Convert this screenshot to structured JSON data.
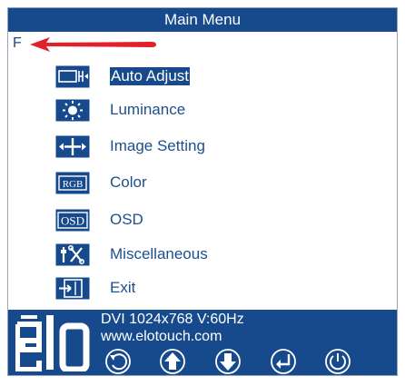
{
  "window": {
    "title": "Main Menu",
    "indicator": "F"
  },
  "menu": {
    "items": [
      {
        "label": "Auto Adjust",
        "icon": "auto-adjust-icon",
        "selected": true
      },
      {
        "label": "Luminance",
        "icon": "luminance-icon",
        "selected": false
      },
      {
        "label": "Image Setting",
        "icon": "image-setting-icon",
        "selected": false
      },
      {
        "label": "Color",
        "icon": "rgb-color-icon",
        "selected": false
      },
      {
        "label": "OSD",
        "icon": "osd-icon",
        "selected": false
      },
      {
        "label": "Miscellaneous",
        "icon": "miscellaneous-icon",
        "selected": false
      },
      {
        "label": "Exit",
        "icon": "exit-icon",
        "selected": false
      }
    ],
    "rgb_icon_text": "RGB",
    "osd_icon_text": "OSD"
  },
  "footer": {
    "brand": "elo",
    "signal": "DVI 1024x768 V:60Hz",
    "website": "www.elotouch.com",
    "buttons": [
      "back-icon",
      "up-arrow-icon",
      "down-arrow-icon",
      "enter-icon",
      "power-icon"
    ]
  },
  "colors": {
    "primary": "#164a8c",
    "text": "#1d4f8f",
    "arrow": "#e0202a"
  }
}
